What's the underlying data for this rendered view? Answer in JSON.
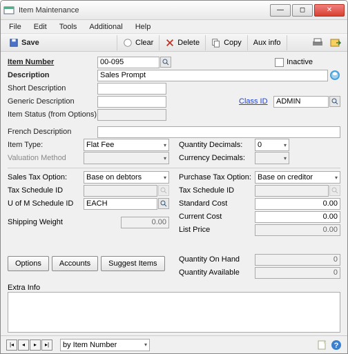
{
  "window": {
    "title": "Item Maintenance"
  },
  "menu": {
    "file": "File",
    "edit": "Edit",
    "tools": "Tools",
    "additional": "Additional",
    "help": "Help"
  },
  "toolbar": {
    "save": "Save",
    "clear": "Clear",
    "delete": "Delete",
    "copy": "Copy",
    "aux": "Aux info"
  },
  "form": {
    "item_number_label": "Item Number",
    "item_number": "00-095",
    "inactive_label": "Inactive",
    "description_label": "Description",
    "description": "Sales Prompt",
    "short_desc_label": "Short Description",
    "short_desc": "",
    "generic_desc_label": "Generic Description",
    "generic_desc": "",
    "class_id_label": "Class ID",
    "class_id": "ADMIN",
    "item_status_label": "Item Status (from Options)",
    "item_status": "",
    "french_desc_label": "French Description",
    "french_desc": "",
    "item_type_label": "Item Type:",
    "item_type": "Flat Fee",
    "qty_decimals_label": "Quantity Decimals:",
    "qty_decimals": "0",
    "valuation_label": "Valuation Method",
    "valuation": "",
    "curr_decimals_label": "Currency Decimals:",
    "curr_decimals": "",
    "sales_tax_label": "Sales Tax Option:",
    "sales_tax": "Base on debtors",
    "purchase_tax_label": "Purchase Tax Option:",
    "purchase_tax": "Base on creditor",
    "tax_schedule_label": "Tax Schedule ID",
    "uofm_label": "U of M Schedule ID",
    "uofm": "EACH",
    "std_cost_label": "Standard Cost",
    "std_cost": "0.00",
    "cur_cost_label": "Current Cost",
    "cur_cost": "0.00",
    "list_price_label": "List Price",
    "list_price": "0.00",
    "ship_weight_label": "Shipping Weight",
    "ship_weight": "0.00",
    "qty_onhand_label": "Quantity On Hand",
    "qty_onhand": "0",
    "qty_avail_label": "Quantity Available",
    "qty_avail": "0"
  },
  "buttons": {
    "options": "Options",
    "accounts": "Accounts",
    "suggest": "Suggest Items"
  },
  "extra": {
    "label": "Extra Info",
    "value": ""
  },
  "status": {
    "sort": "by Item Number"
  }
}
